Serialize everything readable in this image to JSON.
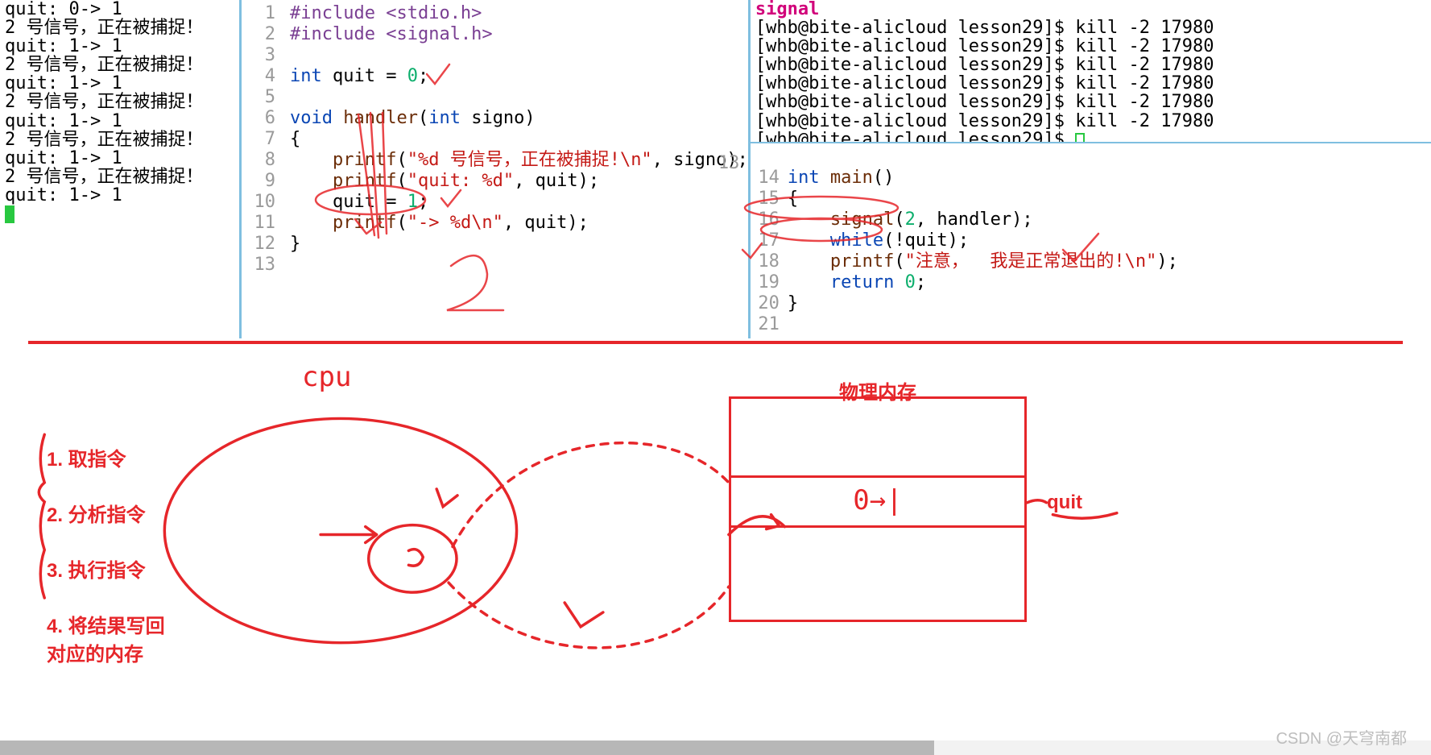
{
  "terminal_left": {
    "lines": [
      "quit: 0-> 1",
      "2 号信号，正在被捕捉！",
      "quit: 1-> 1",
      "2 号信号，正在被捕捉！",
      "quit: 1-> 1",
      "2 号信号，正在被捕捉！",
      "quit: 1-> 1",
      "2 号信号，正在被捕捉！",
      "quit: 1-> 1",
      "2 号信号，正在被捕捉！",
      "quit: 1-> 1"
    ]
  },
  "code_handler": {
    "lineno": [
      "1",
      "2",
      "3",
      "4",
      "5",
      "6",
      "7",
      "8",
      "9",
      "10",
      "11",
      "12",
      "13"
    ],
    "l1a": "#include ",
    "l1b": "<stdio.h>",
    "l2a": "#include ",
    "l2b": "<signal.h>",
    "l4a": "int",
    "l4b": " quit = ",
    "l4c": "0",
    "l4d": ";",
    "l6a": "void",
    "l6b": " ",
    "l6c": "handler",
    "l6d": "(",
    "l6e": "int",
    "l6f": " signo)",
    "l7": "{",
    "l8a": "    ",
    "l8b": "printf",
    "l8c": "(",
    "l8d": "\"%d 号信号，正在被捕捉!\\n\"",
    "l8e": ", signo);",
    "l9a": "    ",
    "l9b": "printf",
    "l9c": "(",
    "l9d": "\"quit: %d\"",
    "l9e": ", quit);",
    "l10a": "    quit = ",
    "l10b": "1",
    "l10c": ";",
    "l11a": "    ",
    "l11b": "printf",
    "l11c": "(",
    "l11d": "\"-> %d\\n\"",
    "l11e": ", quit);",
    "l12": "}"
  },
  "shell_right": {
    "sigword": "signal",
    "prompt": "[whb@bite-alicloud lesson29]$ ",
    "cmd": "kill -2 17980",
    "rows": 6
  },
  "code_main": {
    "lineno": [
      "13",
      "14",
      "15",
      "16",
      "17",
      "18",
      "19",
      "20",
      "21"
    ],
    "extra_lineno": "13",
    "l14a": "int",
    "l14b": " ",
    "l14c": "main",
    "l14d": "()",
    "l15": "{",
    "l16a": "    ",
    "l16b": "signal",
    "l16c": "(",
    "l16d": "2",
    "l16e": ", handler);",
    "l17a": "    ",
    "l17b": "while",
    "l17c": "(!quit);",
    "l18a": "    ",
    "l18b": "printf",
    "l18c": "(",
    "l18d": "\"注意，  我是正常退出的!\\n\"",
    "l18e": ");",
    "l19a": "    ",
    "l19b": "return",
    "l19c": " ",
    "l19d": "0",
    "l19e": ";",
    "l20": "}"
  },
  "board": {
    "cpu": "cpu",
    "mem_label": "物理内存",
    "mem_value": "0→|",
    "quit": "quit",
    "steps": {
      "s1": "1. 取指令",
      "s2": "2. 分析指令",
      "s3": "3. 执行指令",
      "s4": "4. 将结果写回对应的内存"
    }
  },
  "watermark": "CSDN @天穹南都"
}
